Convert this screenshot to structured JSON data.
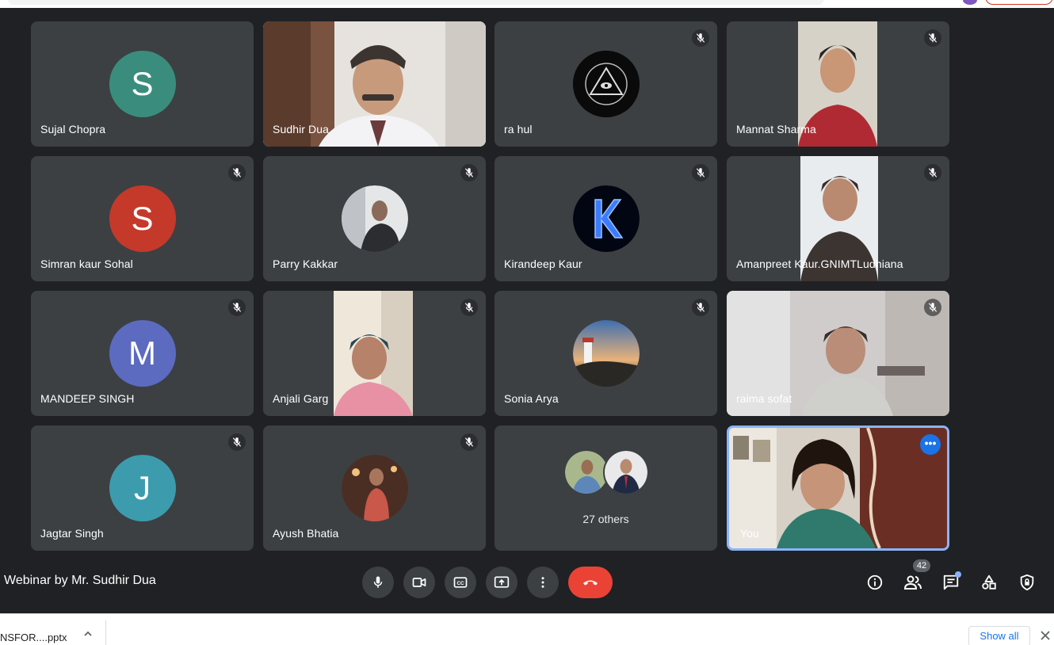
{
  "meeting": {
    "title": "Webinar by Mr. Sudhir Dua",
    "participant_count": "42"
  },
  "tiles": [
    {
      "name": "Sujal Chopra",
      "initial": "S",
      "avatar_color": "#3a8d7c",
      "muted": false
    },
    {
      "name": "Sudhir Dua",
      "muted": false
    },
    {
      "name": "ra hul",
      "muted": true
    },
    {
      "name": "Mannat Sharma",
      "muted": true
    },
    {
      "name": "Simran kaur Sohal",
      "initial": "S",
      "avatar_color": "#c5392a",
      "muted": true
    },
    {
      "name": "Parry Kakkar",
      "muted": true
    },
    {
      "name": "Kirandeep Kaur",
      "muted": true
    },
    {
      "name": "Amanpreet Kaur.GNIMTLudhiana",
      "muted": true
    },
    {
      "name": "MANDEEP SINGH",
      "initial": "M",
      "avatar_color": "#5c6bc0",
      "muted": true
    },
    {
      "name": "Anjali Garg",
      "muted": true
    },
    {
      "name": "Sonia Arya",
      "muted": true
    },
    {
      "name": "raima sofat",
      "muted": true
    },
    {
      "name": "Jagtar Singh",
      "initial": "J",
      "avatar_color": "#3d9bae",
      "muted": true
    },
    {
      "name": "Ayush Bhatia",
      "muted": true
    },
    {
      "name": "",
      "others_label": "27 others"
    },
    {
      "name": "You",
      "self": true
    }
  ],
  "controls": {
    "mic": "mic-icon",
    "camera": "videocam-icon",
    "captions": "closed-caption-icon",
    "present": "present-screen-icon",
    "more": "more-vert-icon",
    "leave": "call-end-icon"
  },
  "right_controls": {
    "info": "info-icon",
    "people": "people-icon",
    "chat": "chat-icon",
    "activities": "activities-icon",
    "host_controls": "shield-lock-icon"
  },
  "downloads": {
    "file_name": "NSFOR....pptx",
    "show_all": "Show all"
  },
  "colors": {
    "end_call": "#ea4335",
    "accent": "#1a73e8",
    "self_border": "#8ab4f8",
    "tile_bg": "#3c4043"
  }
}
